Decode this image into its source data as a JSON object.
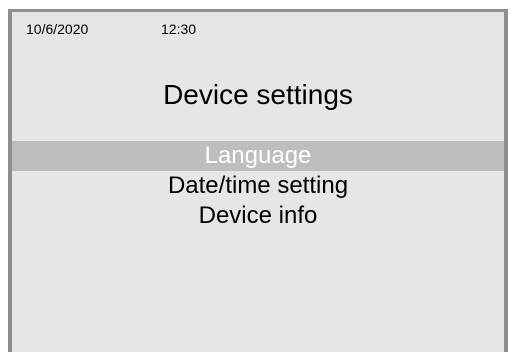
{
  "status": {
    "date": "10/6/2020",
    "time": "12:30"
  },
  "title": "Device settings",
  "menu": {
    "selected_index": 0,
    "items": [
      {
        "label": "Language"
      },
      {
        "label": "Date/time setting"
      },
      {
        "label": "Device info"
      }
    ]
  },
  "colors": {
    "background": "#e6e6e6",
    "frame": "#8e8e8e",
    "selected_background": "#bebebe",
    "selected_text": "#ffffff",
    "text": "#000000"
  }
}
